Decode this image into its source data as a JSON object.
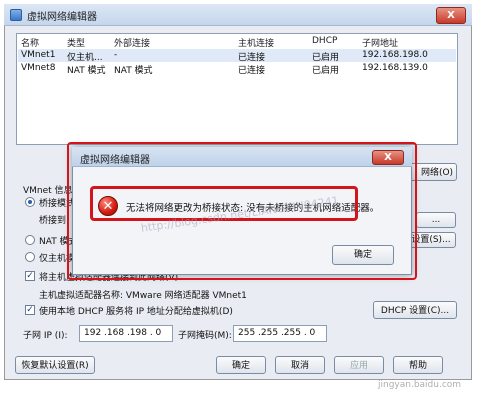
{
  "window": {
    "title": "虚拟网络编辑器",
    "close_glyph": "X"
  },
  "table": {
    "headers": [
      "名称",
      "类型",
      "外部连接",
      "主机连接",
      "DHCP",
      "子网地址"
    ],
    "rows": [
      [
        "VMnet1",
        "仅主机...",
        "-",
        "已连接",
        "已启用",
        "192.168.198.0"
      ],
      [
        "VMnet8",
        "NAT 模式",
        "NAT 模式",
        "已连接",
        "已启用",
        "192.168.139.0"
      ]
    ]
  },
  "partial_labels": {
    "vmnet_info": "VMnet 信息",
    "bridge_mode": "桥接模式",
    "bridge_to": "桥接到",
    "nat_mode": "NAT 模式",
    "host_only": "仅主机模",
    "add_network_suffix": "网络(O)",
    "settings_suffix": "设置(S)...",
    "bridge_settings_suffix": "...",
    "connect_host_adapter": "将主机虚拟适配器连接到此网络(V)"
  },
  "adapter_name_line": "主机虚拟适配器名称: VMware 网络适配器 VMnet1",
  "use_dhcp": "使用本地 DHCP 服务将 IP 地址分配给虚拟机(D)",
  "dhcp_settings_button": "DHCP 设置(C)...",
  "subnet_ip": {
    "label": "子网 IP (I):",
    "value": "192 .168 .198 . 0"
  },
  "subnet_mask": {
    "label": "子网掩码(M):",
    "value": "255 .255 .255 . 0"
  },
  "footer": {
    "restore_defaults": "恢复默认设置(R)",
    "ok": "确定",
    "cancel": "取消",
    "apply": "应用",
    "help": "帮助"
  },
  "dialog": {
    "title": "虚拟网络编辑器",
    "message": "无法将网络更改为桥接状态: 没有未桥接的主机网络适配器。",
    "ok": "确定",
    "close_glyph": "X",
    "error_glyph": "✕"
  },
  "watermark_url": "http://blog.csdn.net/LIANGXIN04241",
  "baidu_watermark": "jingyan.baidu.com",
  "colors": {
    "highlight_red": "#d3141a",
    "selection": "#dfe9f7"
  }
}
